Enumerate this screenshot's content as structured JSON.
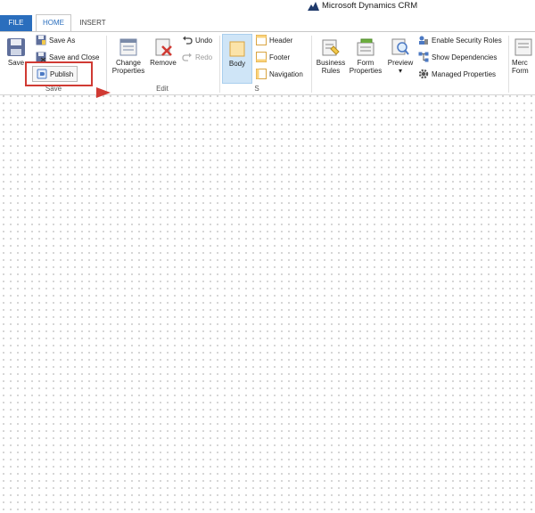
{
  "app": {
    "brand": "Microsoft Dynamics CRM"
  },
  "tabs": {
    "file": "FILE",
    "home": "HOME",
    "insert": "INSERT"
  },
  "groups": {
    "save": {
      "label": "Save",
      "save": "Save",
      "save_as": "Save As",
      "save_and_close": "Save and Close",
      "publish": "Publish"
    },
    "edit": {
      "label": "Edit",
      "change_properties_line1": "Change",
      "change_properties_line2": "Properties",
      "remove": "Remove",
      "undo": "Undo",
      "redo": "Redo"
    },
    "select": {
      "label": "S",
      "body": "Body",
      "header": "Header",
      "footer": "Footer",
      "navigation": "Navigation"
    },
    "form": {
      "business_rules_line1": "Business",
      "business_rules_line2": "Rules",
      "form_properties_line1": "Form",
      "form_properties_line2": "Properties",
      "preview": "Preview",
      "preview_caret": "▾",
      "enable_security_roles": "Enable Security Roles",
      "show_dependencies": "Show Dependencies",
      "managed_properties": "Managed Properties"
    },
    "upgrade": {
      "merge_forms_line1": "Merc",
      "merge_forms_line2": "Form"
    }
  },
  "colors": {
    "file_tab": "#2a6ebd",
    "highlight": "#d03a33",
    "body_selected": "#cfe5f7"
  }
}
